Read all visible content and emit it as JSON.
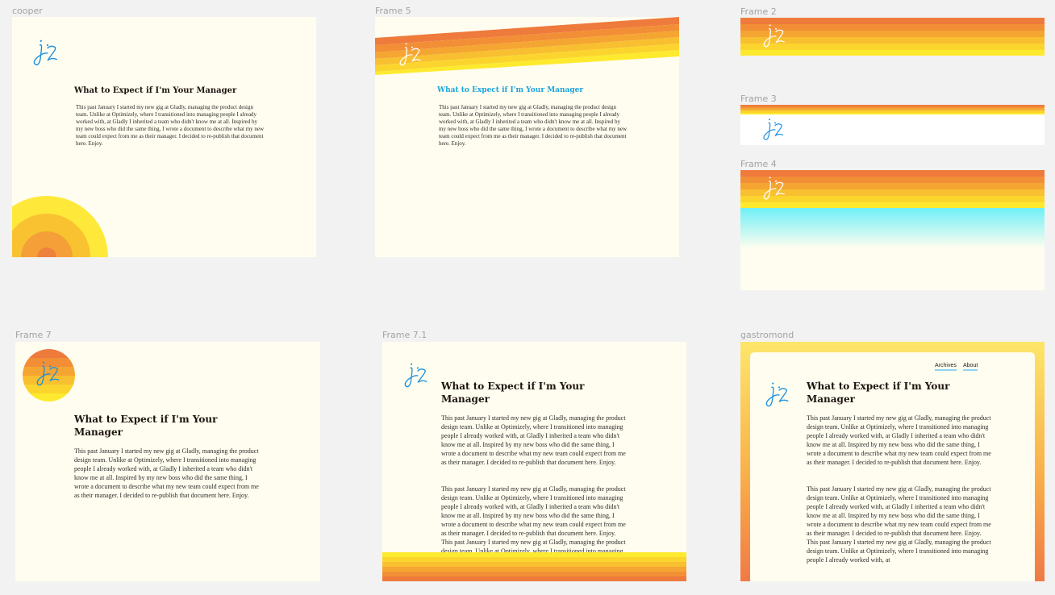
{
  "frames": {
    "cooper": {
      "label": "cooper"
    },
    "frame5": {
      "label": "Frame 5"
    },
    "frame2": {
      "label": "Frame 2"
    },
    "frame3": {
      "label": "Frame 3"
    },
    "frame4": {
      "label": "Frame 4"
    },
    "frame7": {
      "label": "Frame 7"
    },
    "frame71": {
      "label": "Frame 7.1"
    },
    "gastromond": {
      "label": "gastromond"
    }
  },
  "post": {
    "title": "What to Expect if I'm Your Manager",
    "title_line1": "What to Expect if I'm Your",
    "title_line2": "Manager",
    "paragraph": "This past January I started my new gig at Gladly, managing the product design team. Unlike at Optimizely, where I transitioned into managing people I already worked with, at Gladly I inherited a team who didn't know me at all. Inspired by my new boss who did the same thing, I wrote a document to describe what my new team could expect from me as their manager. I decided to re-publish that document here. Enjoy.",
    "paragraph_overflow": "This past January I started my new gig at Gladly, managing the product design team. Unlike at Optimizely, where I transitioned into managing people I already worked with, at Gladly I inherited a team who didn't know me at all. Inspired by my new boss who did the same thing, I wrote a document to describe what my new team could expect from me as their manager. I decided to re-publish that document here. Enjoy. This past January I started my new gig at Gladly, managing the product design team. Unlike at Optimizely, where I transitioned into managing people I already worked with, at"
  },
  "nav": {
    "archives": "Archives",
    "about": "About"
  },
  "logo": {
    "name": "jz-logo-icon"
  },
  "colors": {
    "cream": "#fffdef",
    "canvas": "#f2f2f2",
    "blue": "#1a8fe0",
    "stripes": [
      "#ee7a3c",
      "#f28f36",
      "#f5a532",
      "#f8bf30",
      "#fbd52e",
      "#fdea2f"
    ]
  }
}
